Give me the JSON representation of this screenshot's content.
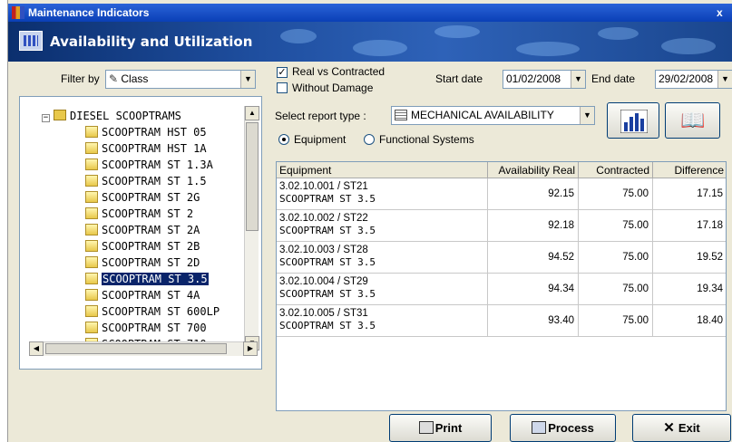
{
  "window": {
    "title": "Maintenance Indicators",
    "close_label": "x"
  },
  "banner": {
    "title": "Availability and Utilization"
  },
  "filter": {
    "label": "Filter by",
    "value": "Class"
  },
  "options": {
    "real_vs_contracted": "Real vs Contracted",
    "without_damage": "Without Damage"
  },
  "dates": {
    "start_label": "Start date",
    "start_value": "01/02/2008",
    "end_label": "End date",
    "end_value": "29/02/2008"
  },
  "report": {
    "label": "Select report type :",
    "value": "MECHANICAL AVAILABILITY",
    "radio_equipment": "Equipment",
    "radio_functional": "Functional Systems"
  },
  "tree": {
    "root": "DIESEL SCOOPTRAMS",
    "items": [
      "SCOOPTRAM HST 05",
      "SCOOPTRAM HST 1A",
      "SCOOPTRAM ST 1.3A",
      "SCOOPTRAM ST 1.5",
      "SCOOPTRAM ST 2G",
      "SCOOPTRAM ST 2",
      "SCOOPTRAM ST 2A",
      "SCOOPTRAM ST 2B",
      "SCOOPTRAM ST 2D",
      "SCOOPTRAM ST 3.5",
      "SCOOPTRAM ST 4A",
      "SCOOPTRAM ST 600LP",
      "SCOOPTRAM ST 700",
      "SCOOPTRAM ST 710"
    ],
    "selected_index": 9
  },
  "table": {
    "headers": [
      "Equipment",
      "Availability Real",
      "Contracted",
      "Difference"
    ],
    "rows": [
      {
        "code": "3.02.10.001 / ST21",
        "name": "SCOOPTRAM  ST 3.5",
        "real": "92.15",
        "contracted": "75.00",
        "diff": "17.15"
      },
      {
        "code": "3.02.10.002 / ST22",
        "name": "SCOOPTRAM  ST 3.5",
        "real": "92.18",
        "contracted": "75.00",
        "diff": "17.18"
      },
      {
        "code": "3.02.10.003 / ST28",
        "name": "SCOOPTRAM  ST 3.5",
        "real": "94.52",
        "contracted": "75.00",
        "diff": "19.52"
      },
      {
        "code": "3.02.10.004 / ST29",
        "name": "SCOOPTRAM  ST 3.5",
        "real": "94.34",
        "contracted": "75.00",
        "diff": "19.34"
      },
      {
        "code": "3.02.10.005 / ST31",
        "name": "SCOOPTRAM  ST 3.5",
        "real": "93.40",
        "contracted": "75.00",
        "diff": "18.40"
      }
    ]
  },
  "buttons": {
    "print": "Print",
    "process": "Process",
    "exit": "Exit"
  },
  "colors": {
    "title_bar": "#0a3fb6",
    "selection": "#0a246a",
    "window_bg": "#ece9d8"
  }
}
